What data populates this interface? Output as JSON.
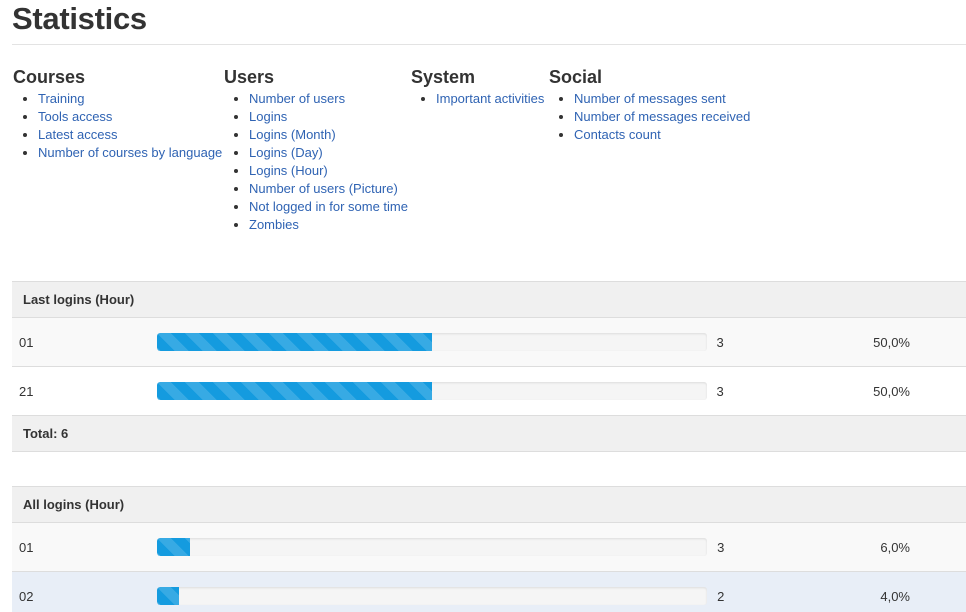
{
  "page": {
    "title": "Statistics"
  },
  "menu": {
    "courses": {
      "heading": "Courses",
      "items": [
        "Training",
        "Tools access",
        "Latest access",
        "Number of courses by language"
      ]
    },
    "users": {
      "heading": "Users",
      "items": [
        "Number of users",
        "Logins",
        "Logins (Month)",
        "Logins (Day)",
        "Logins (Hour)",
        "Number of users (Picture)",
        "Not logged in for some time",
        "Zombies"
      ]
    },
    "system": {
      "heading": "System",
      "items": [
        "Important activities"
      ]
    },
    "social": {
      "heading": "Social",
      "items": [
        "Number of messages sent",
        "Number of messages received",
        "Contacts count"
      ]
    }
  },
  "last_logins": {
    "heading": "Last logins (Hour)",
    "rows": [
      {
        "label": "01",
        "count": "3",
        "percent": "50,0%",
        "fraction": 0.5
      },
      {
        "label": "21",
        "count": "3",
        "percent": "50,0%",
        "fraction": 0.5
      }
    ],
    "total": "Total: 6"
  },
  "all_logins": {
    "heading": "All logins (Hour)",
    "rows": [
      {
        "label": "01",
        "count": "3",
        "percent": "6,0%",
        "fraction": 0.06
      },
      {
        "label": "02",
        "count": "2",
        "percent": "4,0%",
        "fraction": 0.04
      }
    ]
  },
  "colors": {
    "bar": "#149bdf",
    "link": "#2f63b3"
  }
}
